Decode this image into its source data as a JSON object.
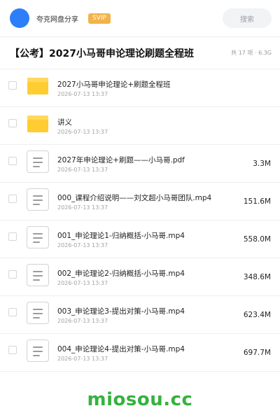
{
  "header": {
    "brand": "夸克网盘分享",
    "badge": "SVIP",
    "search_placeholder": "搜索"
  },
  "title": {
    "text": "【公考】2027小马哥申论理论刷题全程班",
    "summary": "共 17 项 · 6.3G"
  },
  "files": [
    {
      "type": "folder",
      "icon": "folder-icon",
      "name": "2027小马哥申论理论+刷题全程班",
      "date": "2026-07-13 13:37",
      "size": ""
    },
    {
      "type": "folder",
      "icon": "folder-icon",
      "name": "讲义",
      "date": "2026-07-13 13:37",
      "size": ""
    },
    {
      "type": "file",
      "icon": "document-icon",
      "name": "2027年申论理论+刷题——小马哥.pdf",
      "date": "2026-07-13 13:37",
      "size": "3.3M"
    },
    {
      "type": "file",
      "icon": "document-icon",
      "name": "000_课程介绍说明——刘文超小马哥团队.mp4",
      "date": "2026-07-13 13:37",
      "size": "151.6M"
    },
    {
      "type": "file",
      "icon": "document-icon",
      "name": "001_申论理论1-归纳概括-小马哥.mp4",
      "date": "2026-07-13 13:37",
      "size": "558.0M"
    },
    {
      "type": "file",
      "icon": "document-icon",
      "name": "002_申论理论2-归纳概括-小马哥.mp4",
      "date": "2026-07-13 13:37",
      "size": "348.6M"
    },
    {
      "type": "file",
      "icon": "document-icon",
      "name": "003_申论理论3-提出对策-小马哥.mp4",
      "date": "2026-07-13 13:37",
      "size": "623.4M"
    },
    {
      "type": "file",
      "icon": "document-icon",
      "name": "004_申论理论4-提出对策-小马哥.mp4",
      "date": "2026-07-13 13:37",
      "size": "697.7M"
    }
  ],
  "watermark": "miosou.cc",
  "colors": {
    "avatar": "#2d7ff9",
    "badge": "#f3b34a",
    "folder": "#ffcc32",
    "watermark": "#35b23f"
  }
}
